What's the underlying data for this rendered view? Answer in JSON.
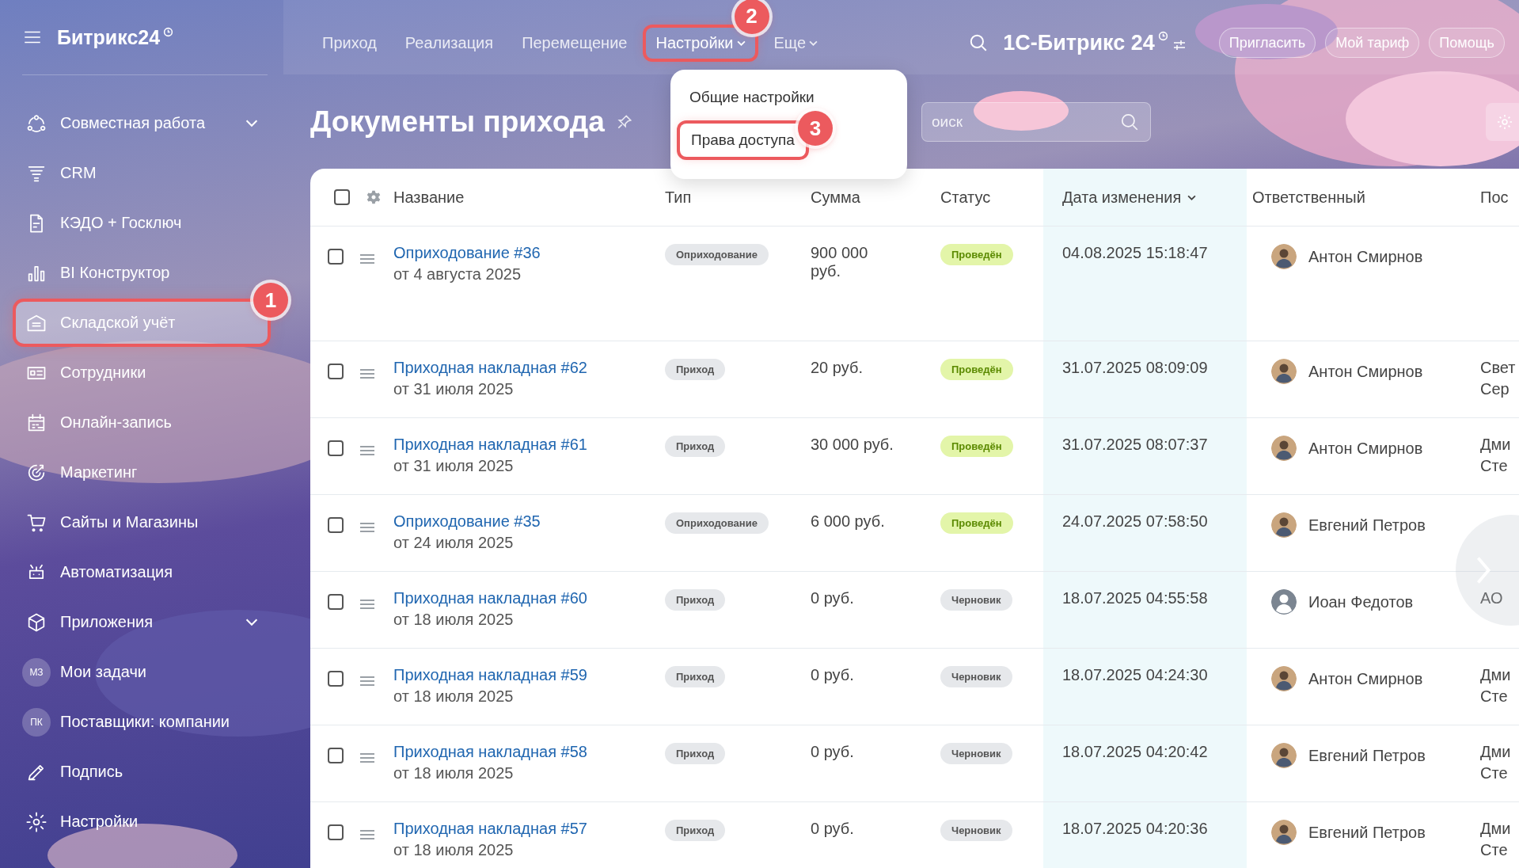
{
  "sidebar": {
    "logo": "Битрикс24",
    "items": [
      {
        "label": "Совместная работа",
        "kind": "icon",
        "has_submenu": true,
        "selected": false
      },
      {
        "label": "CRM",
        "kind": "icon",
        "has_submenu": false,
        "selected": false
      },
      {
        "label": "КЭДО + Госключ",
        "kind": "icon",
        "has_submenu": false,
        "selected": false
      },
      {
        "label": "BI Конструктор",
        "kind": "icon",
        "has_submenu": false,
        "selected": false
      },
      {
        "label": "Складской учёт",
        "kind": "icon",
        "has_submenu": false,
        "selected": true,
        "callout": "1"
      },
      {
        "label": "Сотрудники",
        "kind": "icon",
        "has_submenu": false,
        "selected": false
      },
      {
        "label": "Онлайн-запись",
        "kind": "icon",
        "has_submenu": false,
        "selected": false
      },
      {
        "label": "Маркетинг",
        "kind": "icon",
        "has_submenu": false,
        "selected": false
      },
      {
        "label": "Сайты и Магазины",
        "kind": "icon",
        "has_submenu": false,
        "selected": false
      },
      {
        "label": "Автоматизация",
        "kind": "icon",
        "has_submenu": false,
        "selected": false
      },
      {
        "label": "Приложения",
        "kind": "icon",
        "has_submenu": true,
        "selected": false
      },
      {
        "label": "Мои задачи",
        "kind": "initials",
        "initials": "МЗ",
        "has_submenu": false,
        "selected": false
      },
      {
        "label": "Поставщики: компании",
        "kind": "initials",
        "initials": "ПК",
        "has_submenu": false,
        "selected": false
      },
      {
        "label": "Подпись",
        "kind": "icon",
        "has_submenu": false,
        "selected": false
      },
      {
        "label": "Настройки",
        "kind": "icon",
        "has_submenu": false,
        "selected": false
      }
    ]
  },
  "topbar": {
    "nav": [
      {
        "label": "Приход",
        "dropdown": false,
        "selected": false
      },
      {
        "label": "Реализация",
        "dropdown": false,
        "selected": false
      },
      {
        "label": "Перемещение",
        "dropdown": false,
        "selected": false
      },
      {
        "label": "Настройки",
        "dropdown": true,
        "selected": true,
        "callout": "2"
      },
      {
        "label": "Еще",
        "dropdown": true,
        "selected": false
      }
    ],
    "portal": "1С-Битрикс 24",
    "buttons": [
      "Пригласить",
      "Мой тариф",
      "Помощь"
    ]
  },
  "dropdown": {
    "items": [
      {
        "label": "Общие настройки"
      },
      {
        "label": "Права доступа",
        "callout": "3"
      }
    ]
  },
  "page": {
    "title": "Документы прихода",
    "search": {
      "placeholder": "оиск"
    }
  },
  "table": {
    "header_checked": false,
    "columns": [
      {
        "label": "Название",
        "sorted": false
      },
      {
        "label": "Тип",
        "sorted": false
      },
      {
        "label": "Сумма",
        "sorted": false
      },
      {
        "label": "Статус",
        "sorted": false
      },
      {
        "label": "Дата изменения",
        "sorted": true
      },
      {
        "label": "Ответственный",
        "sorted": false
      },
      {
        "label": "Пос",
        "sorted": false
      }
    ],
    "rows": [
      {
        "checked": false,
        "name": "Оприходование #36",
        "date": "от 4 августа 2025",
        "type": "Оприходование",
        "sum": "900 000 руб.",
        "status": {
          "label": "Проведён",
          "kind": "posted"
        },
        "modified": "04.08.2025 15:18:47",
        "responsible": {
          "name": "Антон Смирнов"
        }
      },
      {
        "checked": false,
        "name": "Приходная накладная #62",
        "date": "от 31 июля 2025",
        "type": "Приход",
        "sum": "20 руб.",
        "status": {
          "label": "Проведён",
          "kind": "posted"
        },
        "modified": "31.07.2025 08:09:09",
        "responsible": {
          "name": "Антон Смирнов"
        },
        "column_7": [
          "Свет",
          "Сер"
        ]
      },
      {
        "checked": false,
        "name": "Приходная накладная #61",
        "date": "от 31 июля 2025",
        "type": "Приход",
        "sum": "30 000 руб.",
        "status": {
          "label": "Проведён",
          "kind": "posted"
        },
        "modified": "31.07.2025 08:07:37",
        "responsible": {
          "name": "Антон Смирнов"
        },
        "column_7": [
          "Дми",
          "Сте"
        ]
      },
      {
        "checked": false,
        "name": "Оприходование #35",
        "date": "от 24 июля 2025",
        "type": "Оприходование",
        "sum": "6 000 руб.",
        "status": {
          "label": "Проведён",
          "kind": "posted"
        },
        "modified": "24.07.2025 07:58:50",
        "responsible": {
          "name": "Евгений Петров"
        }
      },
      {
        "checked": false,
        "name": "Приходная накладная #60",
        "date": "от 18 июля 2025",
        "type": "Приход",
        "sum": "0 руб.",
        "status": {
          "label": "Черновик",
          "kind": "draft"
        },
        "modified": "18.07.2025 04:55:58",
        "responsible": {
          "name": "Иоан Федотов",
          "kind": "default"
        },
        "column_7": [
          "АО"
        ]
      },
      {
        "checked": false,
        "name": "Приходная накладная #59",
        "date": "от 18 июля 2025",
        "type": "Приход",
        "sum": "0 руб.",
        "status": {
          "label": "Черновик",
          "kind": "draft"
        },
        "modified": "18.07.2025 04:24:30",
        "responsible": {
          "name": "Антон Смирнов"
        },
        "column_7": [
          "Дми",
          "Сте"
        ]
      },
      {
        "checked": false,
        "name": "Приходная накладная #58",
        "date": "от 18 июля 2025",
        "type": "Приход",
        "sum": "0 руб.",
        "status": {
          "label": "Черновик",
          "kind": "draft"
        },
        "modified": "18.07.2025 04:20:42",
        "responsible": {
          "name": "Евгений Петров"
        },
        "column_7": [
          "Дми",
          "Сте"
        ]
      },
      {
        "checked": false,
        "name": "Приходная накладная #57",
        "date": "от 18 июля 2025",
        "type": "Приход",
        "sum": "0 руб.",
        "status": {
          "label": "Черновик",
          "kind": "draft"
        },
        "modified": "18.07.2025 04:20:36",
        "responsible": {
          "name": "Евгений Петров"
        },
        "column_7": [
          "Дми",
          "Сте"
        ]
      }
    ]
  }
}
